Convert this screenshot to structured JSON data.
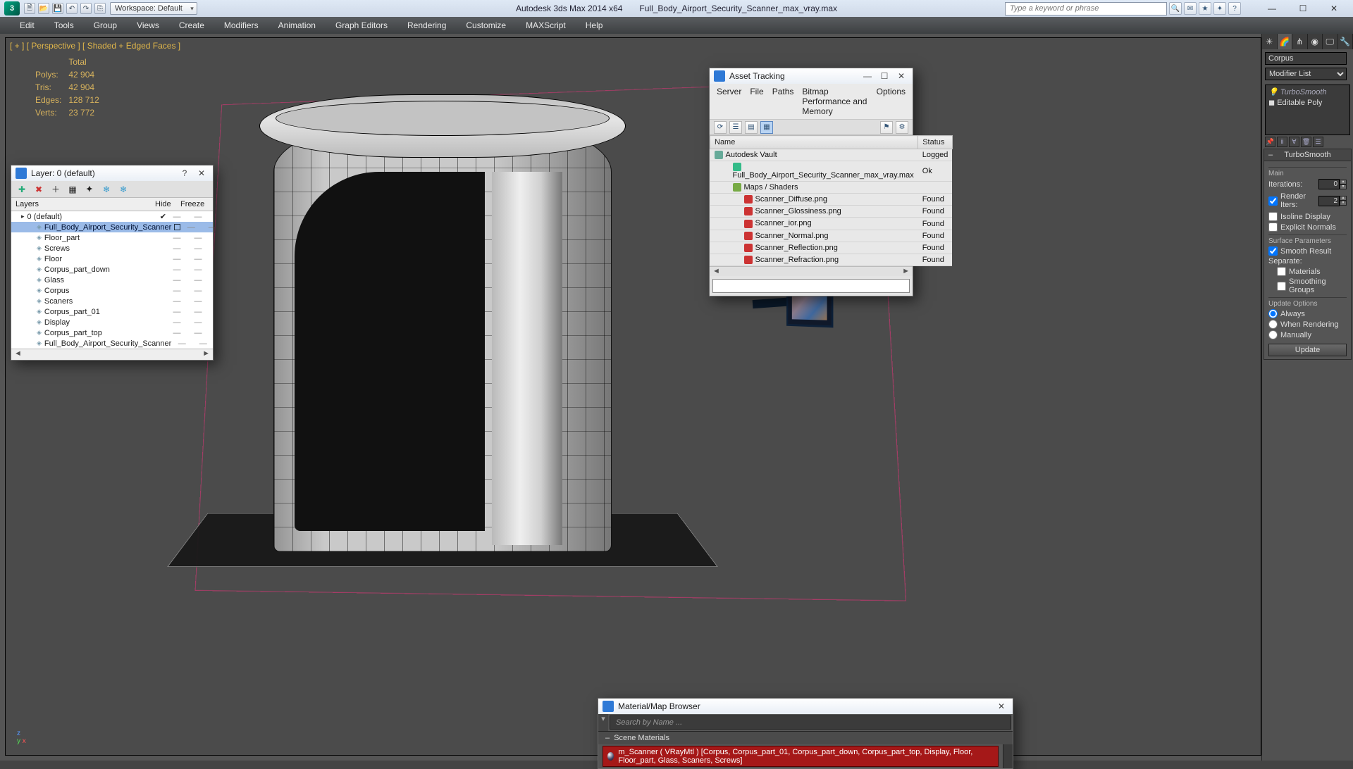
{
  "title": {
    "app": "Autodesk 3ds Max  2014 x64",
    "file": "Full_Body_Airport_Security_Scanner_max_vray.max"
  },
  "workspace": "Workspace: Default",
  "search_placeholder": "Type a keyword or phrase",
  "menus": [
    "Edit",
    "Tools",
    "Group",
    "Views",
    "Create",
    "Modifiers",
    "Animation",
    "Graph Editors",
    "Rendering",
    "Customize",
    "MAXScript",
    "Help"
  ],
  "viewport_label": "[ + ] [ Perspective ] [ Shaded + Edged Faces ]",
  "stats": {
    "header": "Total",
    "polys_l": "Polys:",
    "polys_v": "42 904",
    "tris_l": "Tris:",
    "tris_v": "42 904",
    "edges_l": "Edges:",
    "edges_v": "128 712",
    "verts_l": "Verts:",
    "verts_v": "23 772"
  },
  "layer_dlg": {
    "title": "Layer: 0 (default)",
    "col_layers": "Layers",
    "col_hide": "Hide",
    "col_freeze": "Freeze",
    "rows": [
      {
        "n": "0 (default)",
        "root": true,
        "chk": true
      },
      {
        "n": "Full_Body_Airport_Security_Scanner",
        "sel": true
      },
      {
        "n": "Floor_part"
      },
      {
        "n": "Screws"
      },
      {
        "n": "Floor"
      },
      {
        "n": "Corpus_part_down"
      },
      {
        "n": "Glass"
      },
      {
        "n": "Corpus"
      },
      {
        "n": "Scaners"
      },
      {
        "n": "Corpus_part_01"
      },
      {
        "n": "Display"
      },
      {
        "n": "Corpus_part_top"
      },
      {
        "n": "Full_Body_Airport_Security_Scanner"
      }
    ]
  },
  "asset_dlg": {
    "title": "Asset Tracking",
    "menus": [
      "Server",
      "File",
      "Paths",
      "Bitmap Performance and Memory",
      "Options"
    ],
    "col_name": "Name",
    "col_status": "Status",
    "rows": [
      {
        "n": "Autodesk Vault",
        "st": "Logged",
        "ic": "#6a9"
      },
      {
        "n": "Full_Body_Airport_Security_Scanner_max_vray.max",
        "st": "Ok",
        "ic": "#3b8",
        "ind": 1
      },
      {
        "n": "Maps / Shaders",
        "st": "",
        "ic": "#7a4",
        "ind": 1
      },
      {
        "n": "Scanner_Diffuse.png",
        "st": "Found",
        "ic": "#c33",
        "ind": 2
      },
      {
        "n": "Scanner_Glossiness.png",
        "st": "Found",
        "ic": "#c33",
        "ind": 2
      },
      {
        "n": "Scanner_ior.png",
        "st": "Found",
        "ic": "#c33",
        "ind": 2
      },
      {
        "n": "Scanner_Normal.png",
        "st": "Found",
        "ic": "#c33",
        "ind": 2
      },
      {
        "n": "Scanner_Reflection.png",
        "st": "Found",
        "ic": "#c33",
        "ind": 2
      },
      {
        "n": "Scanner_Refraction.png",
        "st": "Found",
        "ic": "#c33",
        "ind": 2
      }
    ]
  },
  "mat_dlg": {
    "title": "Material/Map Browser",
    "search": "Search by Name ...",
    "section": "Scene Materials",
    "item": "m_Scanner ( VRayMtl )  [Corpus, Corpus_part_01, Corpus_part_down, Corpus_part_top, Display, Floor, Floor_part, Glass, Scaners, Screws]"
  },
  "cmd": {
    "object_name": "Corpus",
    "modlist": "Modifier List",
    "stack": {
      "a": "TurboSmooth",
      "b": "Editable Poly"
    },
    "roll_title": "TurboSmooth",
    "grp_main": "Main",
    "lbl_iter": "Iterations:",
    "val_iter": "0",
    "lbl_riter": "Render Iters:",
    "val_riter": "2",
    "cb_isoline": "Isoline Display",
    "cb_explicit": "Explicit Normals",
    "grp_surf": "Surface Parameters",
    "cb_smooth": "Smooth Result",
    "lbl_sep": "Separate:",
    "cb_mats": "Materials",
    "cb_smgrp": "Smoothing Groups",
    "grp_upd": "Update Options",
    "r_always": "Always",
    "r_rend": "When Rendering",
    "r_man": "Manually",
    "btn_upd": "Update"
  }
}
